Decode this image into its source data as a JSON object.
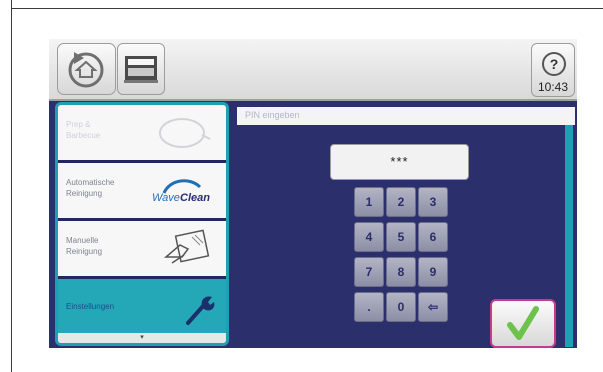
{
  "time": "10:43",
  "help_symbol": "?",
  "menu": {
    "items": [
      {
        "label": "Prep &\nBarbecue",
        "icon": "pan-icon",
        "faded": true
      },
      {
        "label": "Automatische Reinigung",
        "icon": "waveclean-logo",
        "faded": false
      },
      {
        "label": "Manuelle Reinigung",
        "icon": "hand-cleaning-icon",
        "faded": false
      },
      {
        "label": "Einstellungen",
        "icon": "wrench-icon",
        "faded": false,
        "selected": true
      }
    ],
    "scroll_indicator": "▾"
  },
  "waveclean": {
    "wave": "Wave",
    "clean": "Clean"
  },
  "pin": {
    "header": "PIN eingeben",
    "value": "***"
  },
  "keypad": [
    [
      "1",
      "2",
      "3"
    ],
    [
      "4",
      "5",
      "6"
    ],
    [
      "7",
      "8",
      "9"
    ],
    [
      ".",
      "0",
      "⇦"
    ]
  ],
  "colors": {
    "accent": "#1f9fb3",
    "background": "#2b2f6b",
    "confirm_border": "#c43b8d",
    "check": "#6cc24a"
  }
}
